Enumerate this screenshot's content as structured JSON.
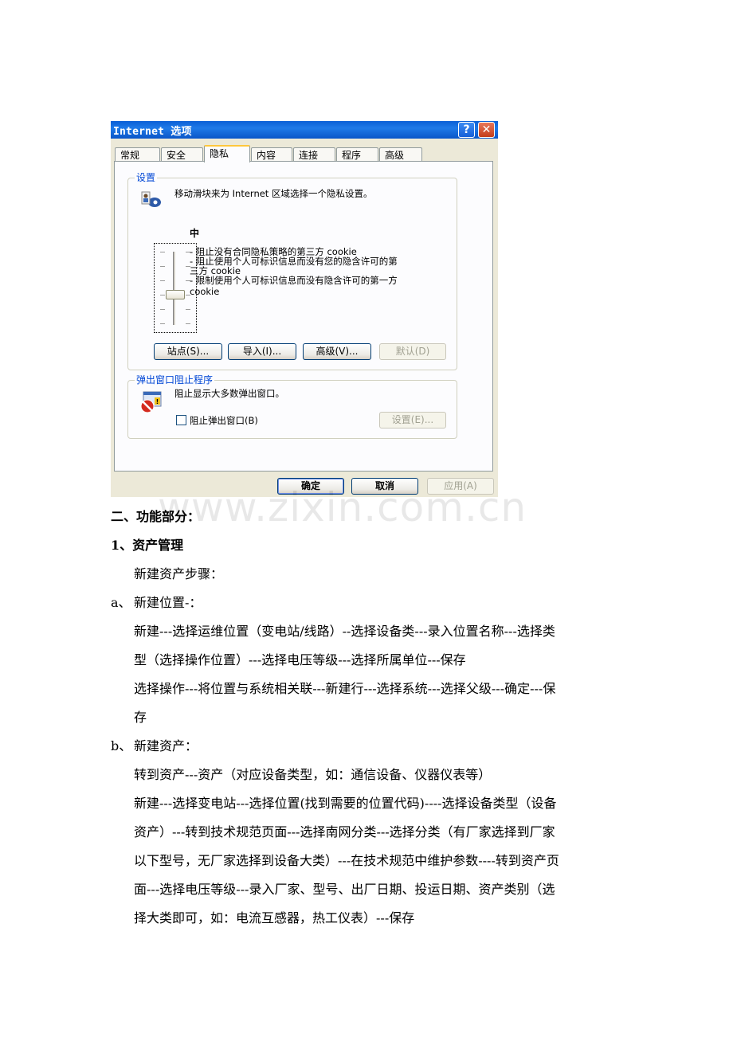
{
  "dialog": {
    "title": "Internet 选项",
    "help_label": "?",
    "close_label": "✕",
    "tabs": [
      {
        "label": "常规",
        "active": false
      },
      {
        "label": "安全",
        "active": false
      },
      {
        "label": "隐私",
        "active": true
      },
      {
        "label": "内容",
        "active": false
      },
      {
        "label": "连接",
        "active": false
      },
      {
        "label": "程序",
        "active": false
      },
      {
        "label": "高级",
        "active": false
      }
    ],
    "settings": {
      "group_label": "设置",
      "instruction": "移动滑块来为 Internet 区域选择一个隐私设置。",
      "level": "中",
      "desc_lines": [
        "- 阻止没有合同隐私策略的第三方 cookie",
        "- 阻止使用个人可标识信息而没有您的隐含许可的第",
        "三方 cookie",
        "- 限制使用个人可标识信息而没有隐含许可的第一方",
        "cookie"
      ],
      "buttons": {
        "sites": "站点(S)...",
        "import": "导入(I)...",
        "advanced": "高级(V)...",
        "default": "默认(D)"
      }
    },
    "popup": {
      "group_label": "弹出窗口阻止程序",
      "description": "阻止显示大多数弹出窗口。",
      "checkbox_label": "阻止弹出窗口(B)",
      "checkbox_checked": false,
      "settings_button": "设置(E)..."
    },
    "footer": {
      "ok": "确定",
      "cancel": "取消",
      "apply": "应用(A)"
    }
  },
  "watermark": "www.zixin.com.cn",
  "document": {
    "section_title": "二、功能部分：",
    "subsection_title": "1、资产管理",
    "intro": "新建资产步骤：",
    "step_a": {
      "marker": "a、",
      "title": "新建位置-：",
      "lines": [
        "新建---选择运维位置（变电站/线路）--选择设备类---录入位置名称---选择类",
        "型（选择操作位置）---选择电压等级---选择所属单位---保存",
        "选择操作---将位置与系统相关联---新建行---选择系统---选择父级---确定---保",
        "存"
      ]
    },
    "step_b": {
      "marker": "b、",
      "title": "新建资产：",
      "lines": [
        "转到资产---资产（对应设备类型，如：通信设备、仪器仪表等）",
        "新建---选择变电站---选择位置(找到需要的位置代码)----选择设备类型（设备",
        "资产）---转到技术规范页面---选择南网分类---选择分类（有厂家选择到厂家",
        "以下型号，无厂家选择到设备大类）---在技术规范中维护参数----转到资产页",
        "面---选择电压等级---录入厂家、型号、出厂日期、投运日期、资产类别（选",
        "择大类即可，如：电流互感器，热工仪表）---保存"
      ]
    }
  }
}
